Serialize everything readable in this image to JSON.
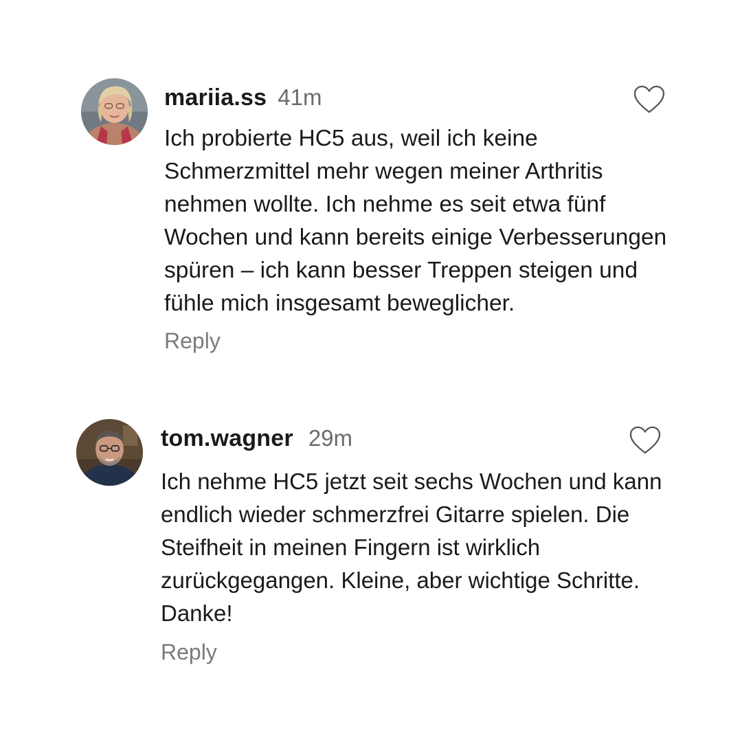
{
  "comments": [
    {
      "username": "mariia.ss",
      "time": "41m",
      "text": "Ich probierte HC5 aus, weil ich keine Schmerzmittel mehr wegen meiner Arthritis nehmen wollte. Ich nehme es seit etwa fünf Wochen und kann bereits einige Verbesserungen spüren – ich kann besser Treppen steigen und fühle mich insgesamt beweglicher.",
      "reply_label": "Reply",
      "like_icon": "heart-outline-icon"
    },
    {
      "username": "tom.wagner",
      "time": "29m",
      "text": "Ich nehme HC5 jetzt seit sechs Wochen und kann endlich wieder schmerzfrei Gitarre spielen. Die Steifheit in meinen Fingern ist wirklich zurückgegangen. Kleine, aber wichtige Schritte. Danke!",
      "reply_label": "Reply",
      "like_icon": "heart-outline-icon"
    }
  ],
  "colors": {
    "username": "#1a1a1a",
    "timestamp": "#6b6b6b",
    "reply": "#7a7a7a",
    "heart_outline": "#555555",
    "background": "#ffffff"
  }
}
